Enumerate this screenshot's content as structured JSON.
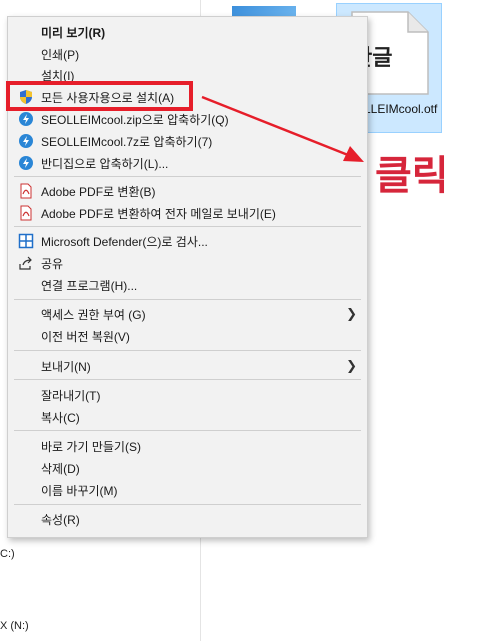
{
  "explorer": {
    "left_fragments": [
      "C:)",
      "X (N:)"
    ],
    "selected_file": {
      "thumb_text": "한글",
      "name": "SEOLLEIMcool.otf"
    }
  },
  "menu": {
    "items": [
      {
        "label": "미리 보기(R)",
        "bold": true
      },
      {
        "label": "인쇄(P)"
      },
      {
        "label": "설치(I)"
      },
      {
        "label": "모든 사용자용으로 설치(A)",
        "icon": "shield-icon"
      },
      {
        "label": "SEOLLEIMcool.zip으로 압축하기(Q)",
        "icon": "bandizip-icon"
      },
      {
        "label": "SEOLLEIMcool.7z로 압축하기(7)",
        "icon": "bandizip-icon"
      },
      {
        "label": "반디집으로 압축하기(L)...",
        "icon": "bandizip-icon"
      },
      {
        "label": "Adobe PDF로 변환(B)",
        "icon": "pdf-icon"
      },
      {
        "label": "Adobe PDF로 변환하여 전자 메일로 보내기(E)",
        "icon": "pdf-icon"
      },
      {
        "label": "Microsoft Defender(으)로 검사...",
        "icon": "defender-icon"
      },
      {
        "label": "공유",
        "icon": "share-icon"
      },
      {
        "label": "연결 프로그램(H)..."
      },
      {
        "label": "액세스 권한 부여 (G)",
        "submenu": true
      },
      {
        "label": "이전 버전 복원(V)"
      },
      {
        "label": "보내기(N)",
        "submenu": true
      },
      {
        "label": "잘라내기(T)"
      },
      {
        "label": "복사(C)"
      },
      {
        "label": "바로 가기 만들기(S)"
      },
      {
        "label": "삭제(D)"
      },
      {
        "label": "이름 바꾸기(M)"
      },
      {
        "label": "속성(R)"
      }
    ]
  },
  "annotation": {
    "click_label": "클릭",
    "color": "#e61e2a"
  }
}
